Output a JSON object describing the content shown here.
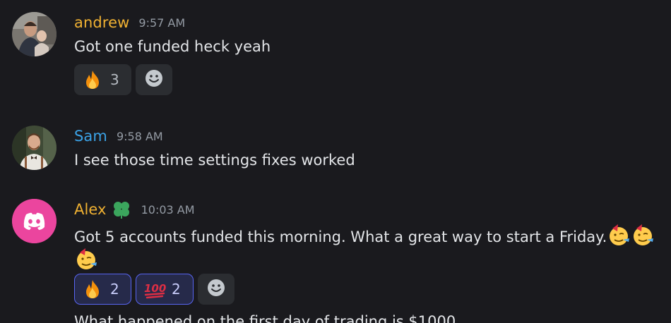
{
  "messages": [
    {
      "author": "andrew",
      "author_color": "#f0b132",
      "time": "9:57 AM",
      "text": "Got one funded heck yeah",
      "reactions": [
        {
          "emoji": "fire-emoji",
          "count": "3",
          "active": false
        }
      ]
    },
    {
      "author": "Sam",
      "author_color": "#3ba2e6",
      "time": "9:58 AM",
      "text": "I see those time settings fixes worked"
    },
    {
      "author": "Alex",
      "author_color": "#f0b132",
      "role_icon": "clover-icon",
      "time": "10:03 AM",
      "text": "Got 5 accounts funded this morning. What a great way to start a Friday.",
      "trailing_emojis": [
        "partying-face-emoji",
        "partying-face-emoji",
        "partying-face-emoji"
      ],
      "reactions": [
        {
          "emoji": "fire-emoji",
          "count": "2",
          "active": true
        },
        {
          "emoji": "hundred-points-emoji",
          "count": "2",
          "active": true
        }
      ]
    }
  ],
  "next_message_partial": "What happened on the first day of trading is $1000",
  "colors": {
    "background": "#1a1a1e",
    "reaction_bg": "#2b2d31",
    "reaction_active_border": "#5865f2",
    "discord_avatar": "#eb459e"
  }
}
